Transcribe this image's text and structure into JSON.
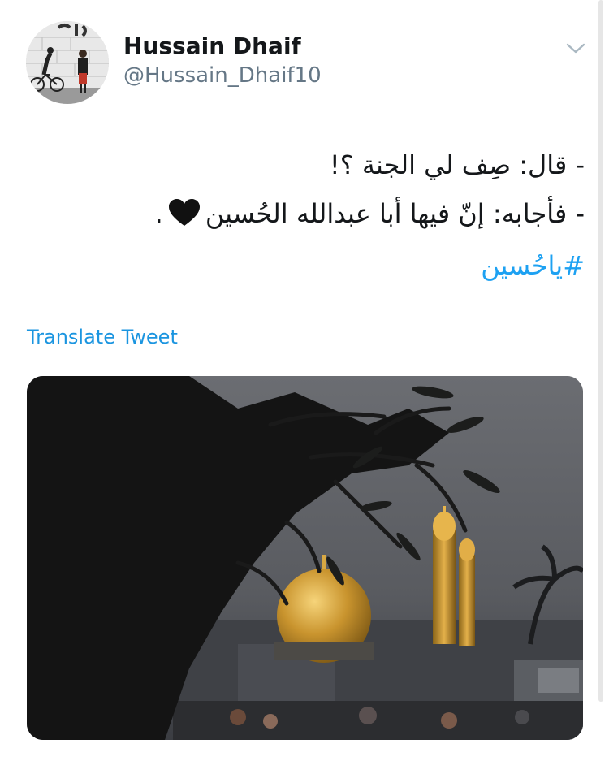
{
  "tweet": {
    "author": {
      "display_name": "Hussain Dhaif",
      "handle": "@Hussain_Dhaif10",
      "avatar_icon": "avatar-photo-icon"
    },
    "menu_icon": "chevron-down-icon",
    "text_lines": [
      "- قال: صِف لي الجنة ؟!",
      "- فأجابه: إنّ فيها أبا عبدالله الحُسين"
    ],
    "line2_suffix": ".",
    "emoji": "black-heart-icon",
    "hashtag": "#ياحُسين",
    "translate_label": "Translate Tweet",
    "media_icon": "shrine-photo-icon"
  },
  "colors": {
    "text": "#14171a",
    "secondary": "#657786",
    "link": "#1b95e0",
    "hashtag": "#1da1f2"
  }
}
